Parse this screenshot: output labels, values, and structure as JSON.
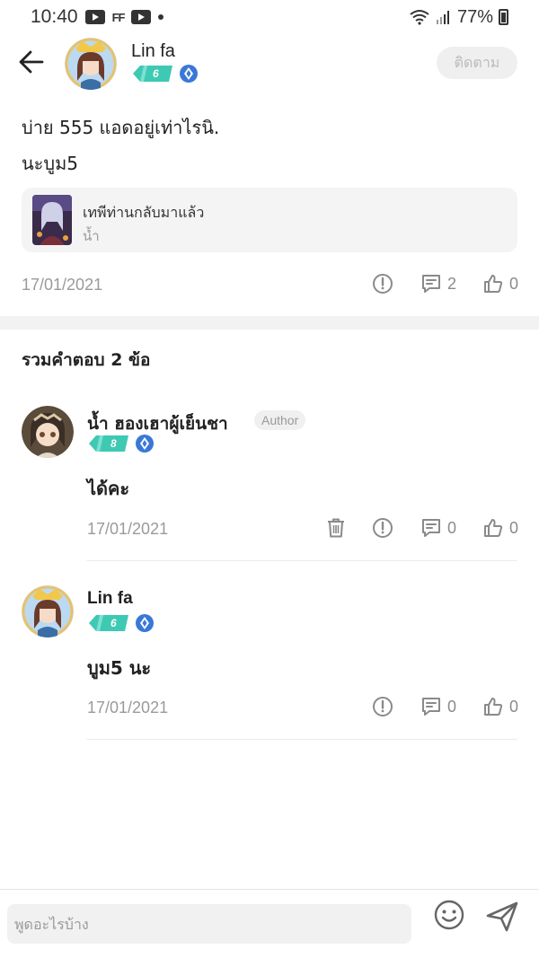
{
  "status_bar": {
    "time": "10:40",
    "battery": "77%",
    "ff_label": "FF"
  },
  "header": {
    "user_name": "Lin fa",
    "user_level": "6",
    "follow_label": "ติดตาม"
  },
  "post": {
    "line1": "บ่าย  555  แอดอยู่เท่าไรนิ.",
    "line2": "นะบูม5",
    "book": {
      "title": "เทพีท่านกลับมาแล้ว",
      "author": "น้ำ"
    },
    "date": "17/01/2021",
    "comment_count": "2",
    "like_count": "0"
  },
  "replies": {
    "title": "รวมคำตอบ 2 ข้อ",
    "items": [
      {
        "name": "น้ำ ฮองเฮาผู้เย็นชา",
        "tag": "Author",
        "level": "8",
        "text": "ได้คะ",
        "date": "17/01/2021",
        "comment_count": "0",
        "like_count": "0"
      },
      {
        "name": "Lin fa",
        "level": "6",
        "text": "บูม5 นะ",
        "date": "17/01/2021",
        "comment_count": "0",
        "like_count": "0"
      }
    ]
  },
  "input": {
    "placeholder": "พูดอะไรบ้าง"
  },
  "colors": {
    "level_badge": "#3ec9b3",
    "gem": "#3a78d8",
    "muted": "#9a9a9a"
  },
  "icons": [
    "back-arrow-icon",
    "report-icon",
    "comment-icon",
    "like-icon",
    "trash-icon",
    "emoji-icon",
    "send-icon",
    "gem-icon"
  ]
}
